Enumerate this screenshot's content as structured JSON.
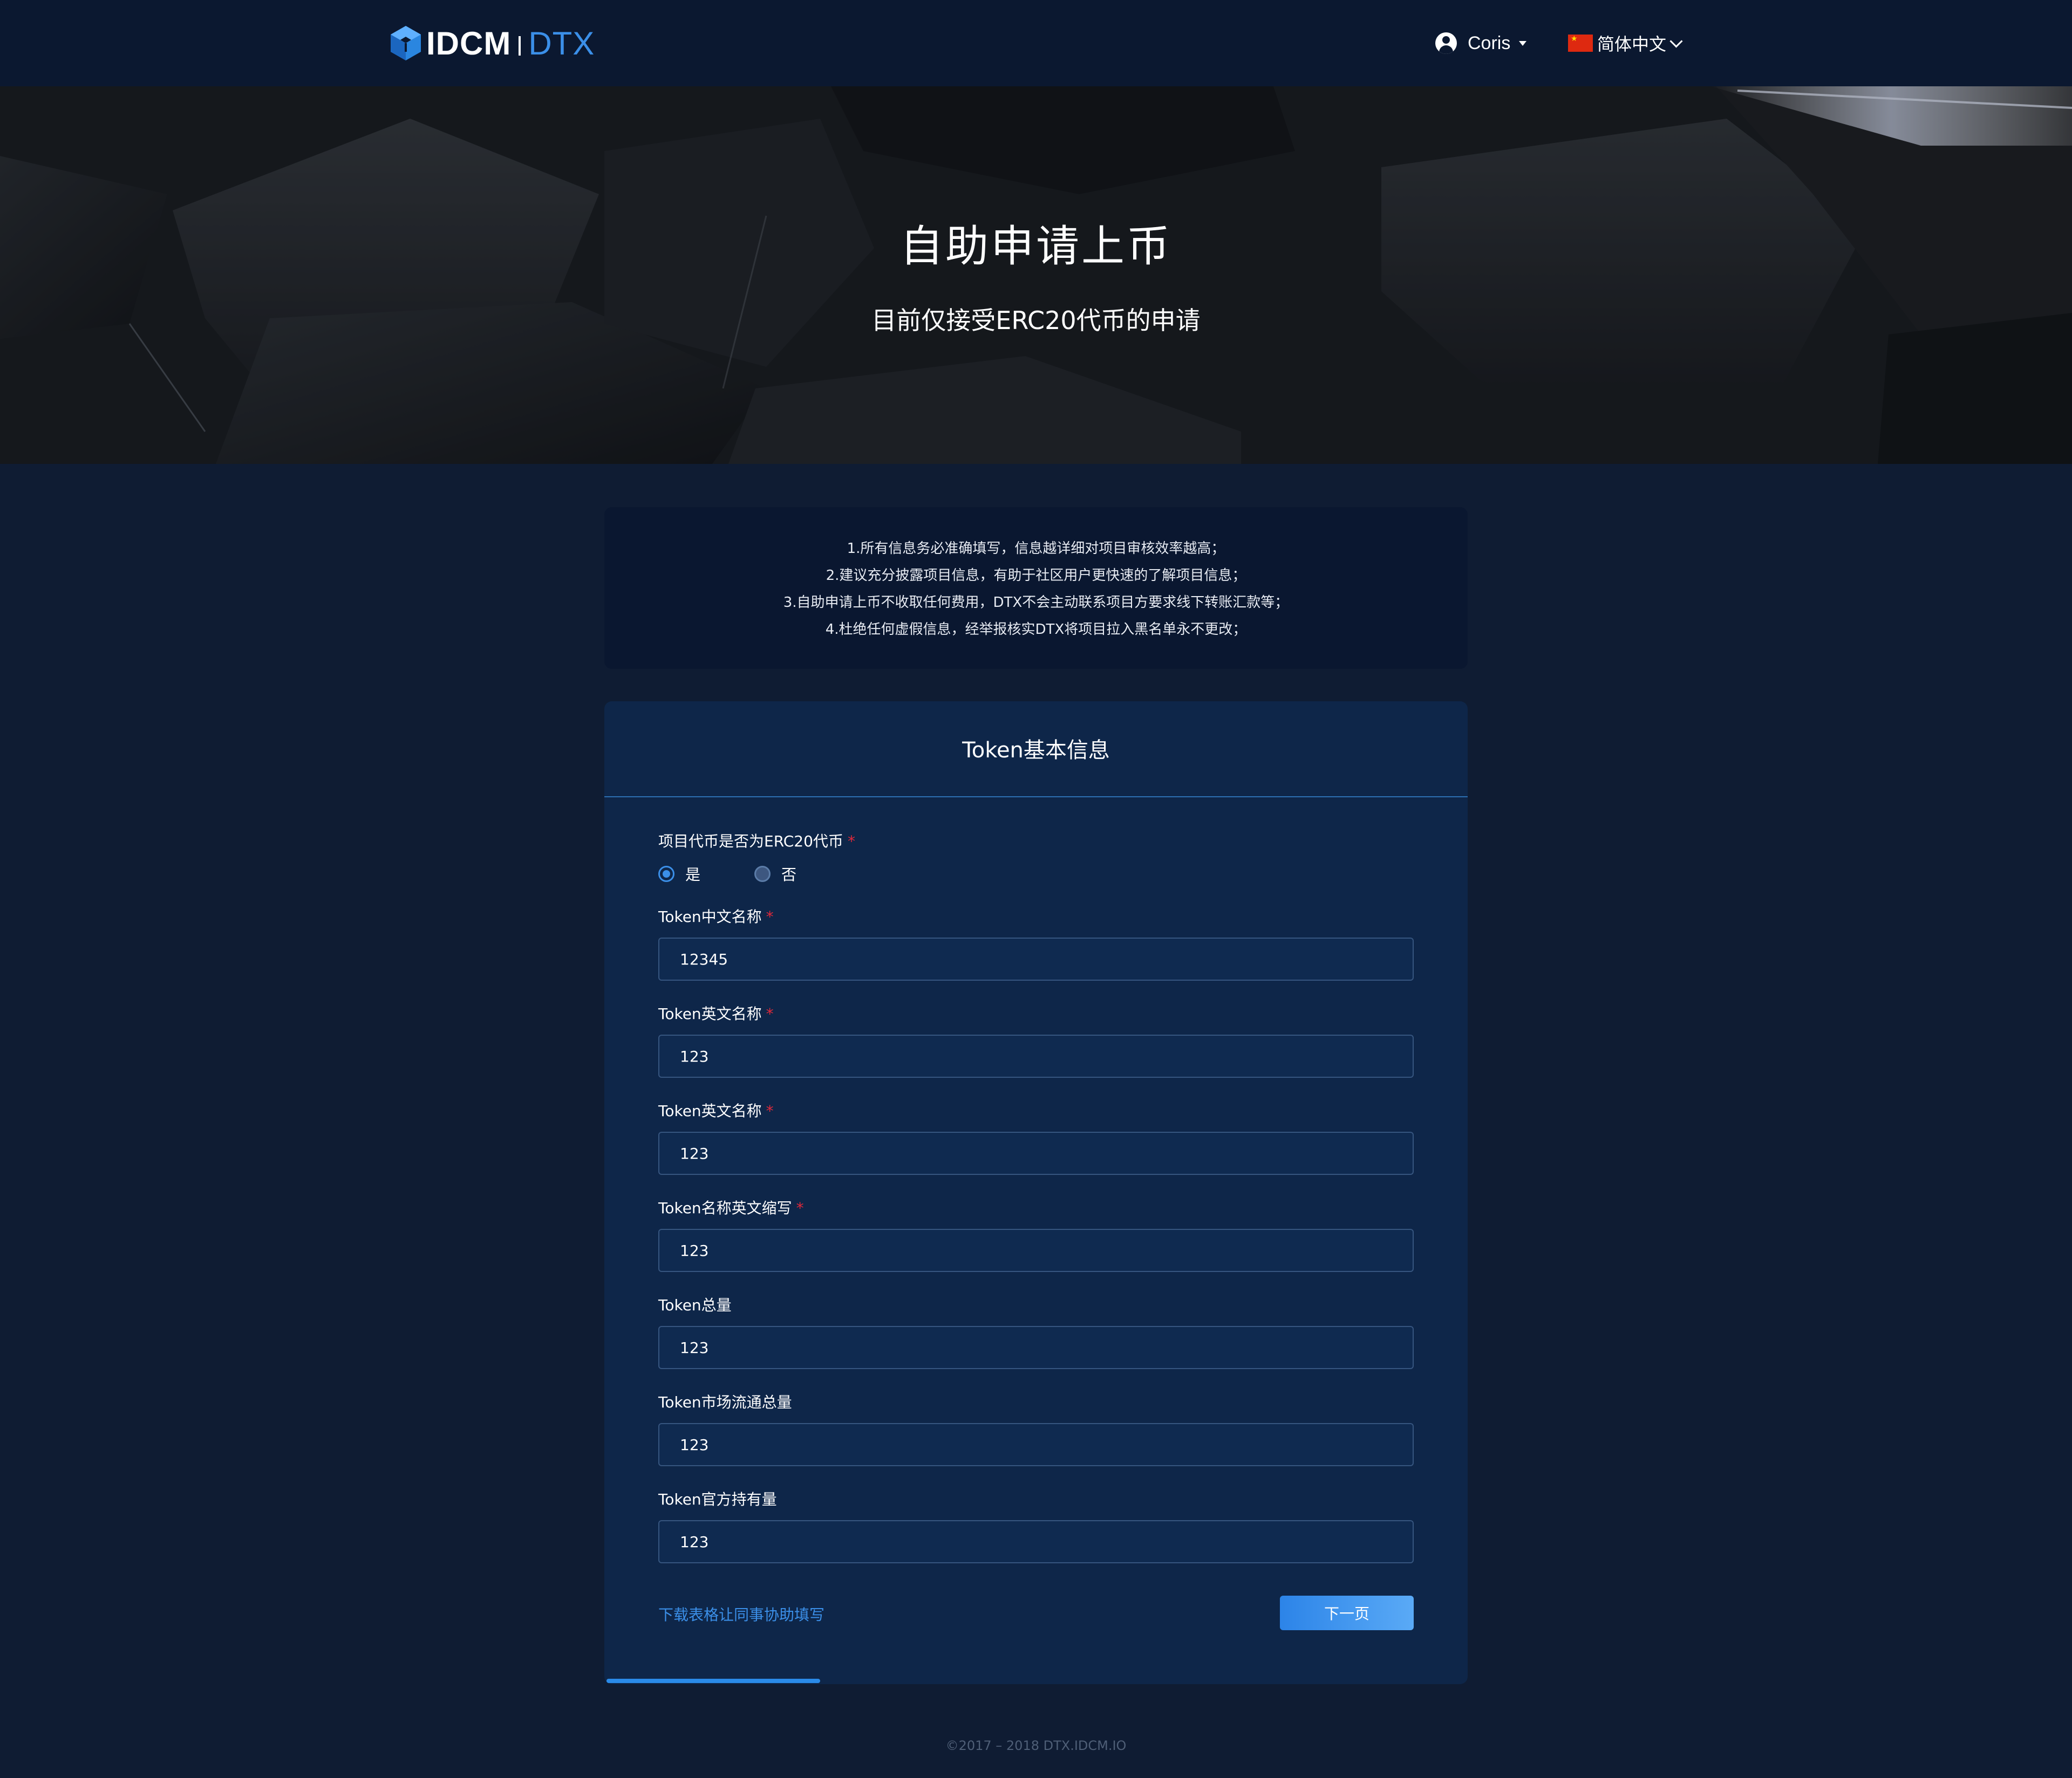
{
  "header": {
    "logo_brand": "IDCM",
    "logo_product": "DTX",
    "user_name": "Coris",
    "language": "简体中文"
  },
  "banner": {
    "title": "自助申请上币",
    "subtitle": "目前仅接受ERC20代币的申请"
  },
  "notice": {
    "lines": [
      "1.所有信息务必准确填写，信息越详细对项目审核效率越高；",
      "2.建议充分披露项目信息，有助于社区用户更快速的了解项目信息；",
      "3.自助申请上币不收取任何费用，DTX不会主动联系项目方要求线下转账汇款等；",
      "4.杜绝任何虚假信息，经举报核实DTX将项目拉入黑名单永不更改；"
    ]
  },
  "form": {
    "title": "Token基本信息",
    "erc20_question": "项目代币是否为ERC20代币",
    "required_mark": "*",
    "options": {
      "yes": "是",
      "no": "否",
      "selected": "yes"
    },
    "fields": [
      {
        "label": "Token中文名称",
        "required": true,
        "value": "12345"
      },
      {
        "label": "Token英文名称",
        "required": true,
        "value": "123"
      },
      {
        "label": "Token英文名称",
        "required": true,
        "value": "123"
      },
      {
        "label": "Token名称英文缩写",
        "required": true,
        "value": "123"
      },
      {
        "label": "Token总量",
        "required": false,
        "value": "123"
      },
      {
        "label": "Token市场流通总量",
        "required": false,
        "value": "123"
      },
      {
        "label": "Token官方持有量",
        "required": false,
        "value": "123"
      }
    ],
    "download_link": "下载表格让同事协助填写",
    "next_button": "下一页",
    "progress": 0.25
  },
  "footer": {
    "copyright": "©2017 – 2018 DTX.IDCM.IO"
  },
  "colors": {
    "background": "#0f1c33",
    "header": "#0b1830",
    "card": "#0e2649",
    "accent": "#3b8fe8",
    "required": "#e0283a"
  }
}
